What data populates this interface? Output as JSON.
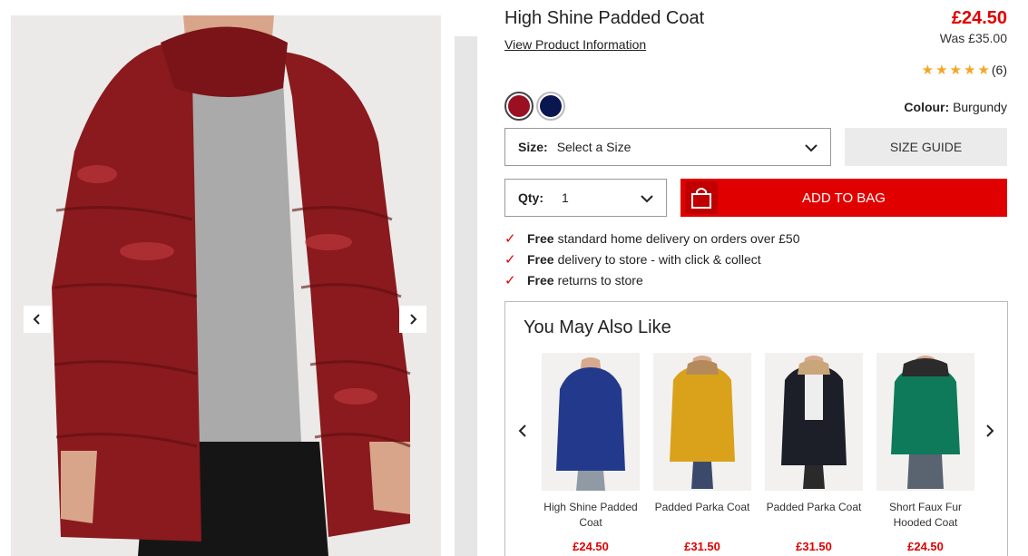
{
  "product": {
    "title": "High Shine Padded Coat",
    "info_link": "View Product Information",
    "price": "£24.50",
    "was_price": "Was £35.00",
    "rating_stars": 5,
    "rating_count": "(6)"
  },
  "colour": {
    "label": "Colour:",
    "value": "Burgundy",
    "swatches": [
      {
        "name": "burgundy",
        "color": "#9b0f22"
      },
      {
        "name": "navy",
        "color": "#0a1650"
      }
    ]
  },
  "size": {
    "label": "Size:",
    "value": "Select a Size",
    "guide": "SIZE GUIDE"
  },
  "qty": {
    "label": "Qty:",
    "value": "1"
  },
  "cart": {
    "add_label": "ADD TO BAG"
  },
  "perks": [
    {
      "bold": "Free",
      "text": "standard home delivery on orders over £50"
    },
    {
      "bold": "Free",
      "text": "delivery to store - with click & collect"
    },
    {
      "bold": "Free",
      "text": "returns to store"
    }
  ],
  "recommendations": {
    "title": "You May Also Like",
    "items": [
      {
        "name": "High Shine Padded Coat",
        "price": "£24.50",
        "coat_color": "#233a8c"
      },
      {
        "name": "Padded Parka Coat",
        "price": "£31.50",
        "coat_color": "#d9a21a"
      },
      {
        "name": "Padded Parka Coat",
        "price": "£31.50",
        "coat_color": "#1c1f28"
      },
      {
        "name": "Short Faux Fur Hooded Coat",
        "price": "£24.50",
        "coat_color": "#0f7a5a"
      }
    ]
  },
  "colors": {
    "accent": "#e10000",
    "star": "#f5a623"
  },
  "icons": [
    "chevron-left-icon",
    "chevron-right-icon",
    "chevron-down-icon",
    "shopping-bag-icon",
    "check-icon",
    "star-icon"
  ]
}
